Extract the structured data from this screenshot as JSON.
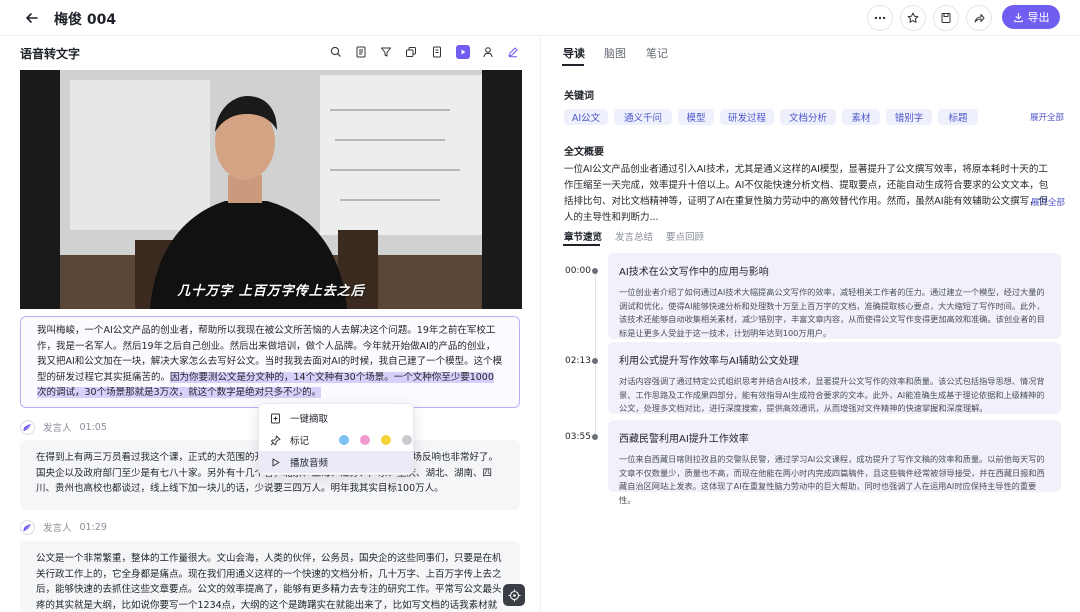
{
  "header": {
    "title": "梅俊 004",
    "export_label": "导出"
  },
  "left": {
    "title": "语音转文字",
    "video_subtitle": "几十万字 上百万字传上去之后",
    "para1_normal": "我叫梅峻，一个AI公文产品的创业者，帮助所以我现在被公文所苦恼的人去解决这个问题。19年之前在军校工作，我是一名军人。然后19年之后自己创业。然后出来做培训，做个人品牌。今年就开始做AI的产品的创业，我又把AI和公文加在一块，解决大家怎么去写好公文。当时我我去面对AI的时候，我自己建了一个模型。这个模型的研发过程它其实挺痛苦的。",
    "para1_highlight": "因为你要测公文是分文种的，14个文种有30个场景。一个文种你至少要1000次的调试，30个场景那就是3万次，就这个数字是绝对只多不少的。",
    "segments": [
      {
        "speaker": "发言人",
        "time": "01:05",
        "text": "在得到上有两三万员看过我这个课，正式的大范围的开放，就是今年的3月份开始，这个市场反响也非常好了。国央企以及政府部门至少是有七八十家。另外有十几个省，北京、上海、江苏、广东、重庆、湖北、湖南、四川、贵州也高校也都谈过，线上线下加一块儿的话，少说要三四万人。明年我其实目标100万人。"
      },
      {
        "speaker": "发言人",
        "time": "01:29",
        "text": "公文是一个非常繁重，整体的工作量很大。文山会海，人类的伙伴，公务员，国央企的这些同事们，只要是在机关行政工作上的，它全身都是痛点。现在我们用通义这样的一个快速的文档分析，几十万字、上百万字传上去之后，能够快速的去抓住这些文章要点。公文的效率提高了，能够有更多精力去专注的研究工作。平常写公文最头疼的其实就是大纲，比如说你要写一个1234点，大纲的这个是踌躇实在就能出来了，比如写文档的话我素材就要找好几天，现在AI可以在"
      }
    ],
    "context_menu": {
      "excerpt": "一键摘取",
      "mark": "标记",
      "play": "播放音频",
      "mark_colors": [
        "#7ec3f0",
        "#f09ad0",
        "#f5d43a",
        "#c9cbd1"
      ]
    }
  },
  "right": {
    "tabs": [
      "导读",
      "脑图",
      "笔记"
    ],
    "keywords_title": "关键词",
    "keywords": [
      "AI公文",
      "通义千问",
      "模型",
      "研发过程",
      "文档分析",
      "素材",
      "错别字",
      "标题"
    ],
    "expand_all": "展开全部",
    "summary_title": "全文概要",
    "summary": "一位AI公文产品创业者通过引入AI技术，尤其是通义这样的AI模型，显著提升了公文撰写效率，将原本耗时十天的工作压缩至一天完成，效率提升十倍以上。AI不仅能快速分析文档、提取要点，还能自动生成符合要求的公文文本，包括排比句、对比文档精神等，证明了AI在重复性脑力劳动中的高效替代作用。然而，虽然AI能有效辅助公文撰写，但人的主导性和判断力...",
    "expand_all_2": "展开全部",
    "sub_tabs": [
      "章节速览",
      "发言总结",
      "要点回顾"
    ],
    "chapters": [
      {
        "time": "00:00",
        "title": "AI技术在公文写作中的应用与影响",
        "body": "一位创业者介绍了如何通过AI技术大幅提高公文写作的效率，减轻相关工作者的压力。通过建立一个模型，经过大量的调试和优化，使得AI能够快速分析和处理数十万至上百万字的文档，准确提取核心要点，大大缩短了写作时间。此外，该技术还能够自动收集相关素材，减少错别字，丰富文章内容，从而使得公文写作变得更加高效和准确。该创业者的目标是让更多人受益于这一技术，计划明年达到100万用户。"
      },
      {
        "time": "02:13",
        "title": "利用公式提升写作效率与AI辅助公文处理",
        "body": "对话内容强调了通过特定公式组织思考并结合AI技术，显著提升公文写作的效率和质量。该公式包括指导思想、情况背景、工作思路及工作成果四部分，能有效指导AI生成符合要求的文本。此外，AI能准确生成基于理论依据和上级精神的公文，处理多文档对比，进行深度搜索，提供高效通讯，从而增强对文件精神的快速掌握和深度理解。"
      },
      {
        "time": "03:55",
        "title": "西藏民警利用AI提升工作效率",
        "body": "一位来自西藏日喀则拉孜县的交警队民警，通过学习AI公文课程，成功提升了写作文稿的效率和质量。以前他每天写的文章不仅数量少，质量也不高，而现在他能在两小时内完成四篇稿件，且这些稿件经常被领导接受，并在西藏日报和西藏自治区网站上发表。这体现了AI在重复性脑力劳动中的巨大帮助，同时也强调了人在运用AI时应保持主导性的重要性。"
      }
    ]
  },
  "colors": {
    "accent": "#6f5ef0",
    "highlight": "#d6d0fa",
    "chapter_bg": "#f2f1fb"
  }
}
